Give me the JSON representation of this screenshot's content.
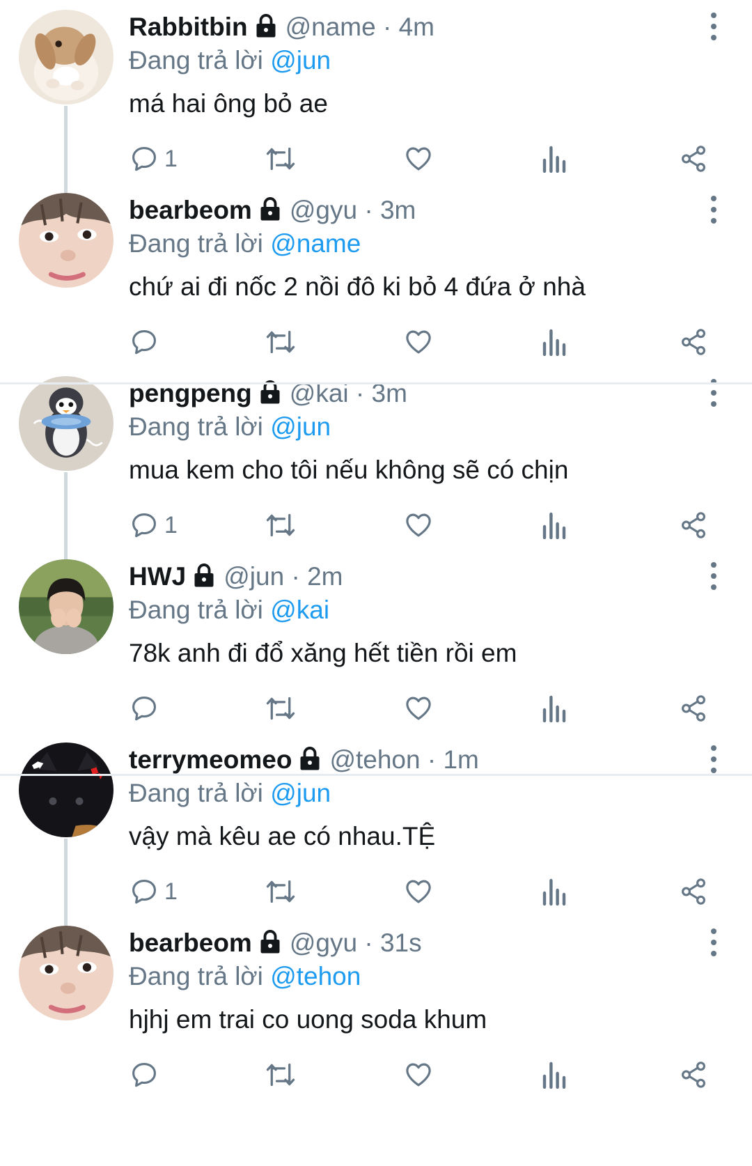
{
  "replying_prefix": "Đang trả lời ",
  "dot": " · ",
  "tweets": [
    {
      "name": "Rabbitbin",
      "handle": "@name",
      "time": "4m",
      "reply_to": "@jun",
      "text": "má hai ông bỏ ae",
      "reply_count": "1",
      "avatar": "rabbit",
      "thread_continues": true
    },
    {
      "name": "bearbeom",
      "handle": "@gyu",
      "time": "3m",
      "reply_to": "@name",
      "text": "chứ ai đi nốc 2 nồi đô ki bỏ 4 đứa ở nhà",
      "reply_count": "",
      "avatar": "face",
      "thread_continues": false
    },
    {
      "name": "pengpeng",
      "handle": "@kai",
      "time": "3m",
      "reply_to": "@jun",
      "text": "mua kem cho tôi nếu không sẽ có chịn",
      "reply_count": "1",
      "avatar": "penguin",
      "thread_continues": true
    },
    {
      "name": "HWJ",
      "handle": "@jun",
      "time": "2m",
      "reply_to": "@kai",
      "text": "78k anh đi đổ xăng hết tiền rồi em",
      "reply_count": "",
      "avatar": "person",
      "thread_continues": false
    },
    {
      "name": "terrymeomeo",
      "handle": "@tehon",
      "time": "1m",
      "reply_to": "@jun",
      "text": "vậy mà kêu ae có nhau.TỆ",
      "reply_count": "1",
      "avatar": "cat",
      "thread_continues": true
    },
    {
      "name": "bearbeom",
      "handle": "@gyu",
      "time": "31s",
      "reply_to": "@tehon",
      "text": "hjhj em trai co uong soda khum",
      "reply_count": "",
      "avatar": "face",
      "thread_continues": false
    }
  ],
  "icons": {
    "reply": "reply-icon",
    "retweet": "retweet-icon",
    "like": "heart-icon",
    "stats": "analytics-icon",
    "share": "share-icon",
    "lock": "lock-icon",
    "more": "more-vertical-icon"
  },
  "colors": {
    "mention": "#1d9bf0",
    "secondary": "#657786",
    "text": "#14171a",
    "thread_line": "#cfd9de"
  }
}
